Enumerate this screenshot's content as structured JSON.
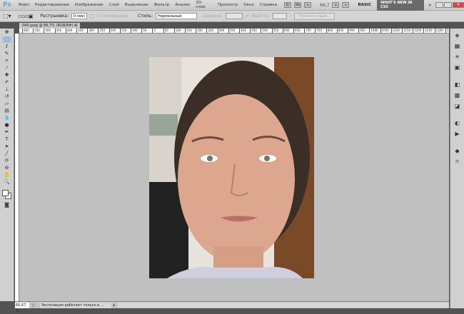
{
  "app": {
    "logo": "Ps"
  },
  "menu": [
    "Файл",
    "Редактирование",
    "Изображение",
    "Слой",
    "Выделение",
    "Фильтр",
    "Анализ",
    "3D-слои",
    "Просмотр",
    "Окно",
    "Справка"
  ],
  "appbar": {
    "zoom": "66,7",
    "workspace": "BASIC",
    "whats_new": "WHAT'S NEW IN CS5"
  },
  "options": {
    "feather_label": "Растушевка:",
    "feather_value": "0 пикс",
    "antialias_label": "Сглаживание",
    "style_label": "Стиль:",
    "style_value": "Нормальный",
    "width_label": "Ширина:",
    "height_label": "Высота:",
    "refine_edge": "Уточнить край..."
  },
  "document": {
    "tab": "040.jpeg @ 66,7% (RGB/8#)"
  },
  "ruler": [
    "600",
    "550",
    "500",
    "450",
    "400",
    "350",
    "300",
    "250",
    "200",
    "150",
    "100",
    "50",
    "0",
    "50",
    "100",
    "150",
    "200",
    "250",
    "300",
    "350",
    "400",
    "450",
    "500",
    "550",
    "600",
    "650",
    "700",
    "750",
    "800",
    "850",
    "900",
    "950",
    "1000",
    "1050",
    "1100",
    "1150",
    "1200",
    "1250",
    "1300",
    "1350"
  ],
  "status": {
    "zoom": "66,67 %",
    "text": "Экспозиция работает только в ..."
  }
}
